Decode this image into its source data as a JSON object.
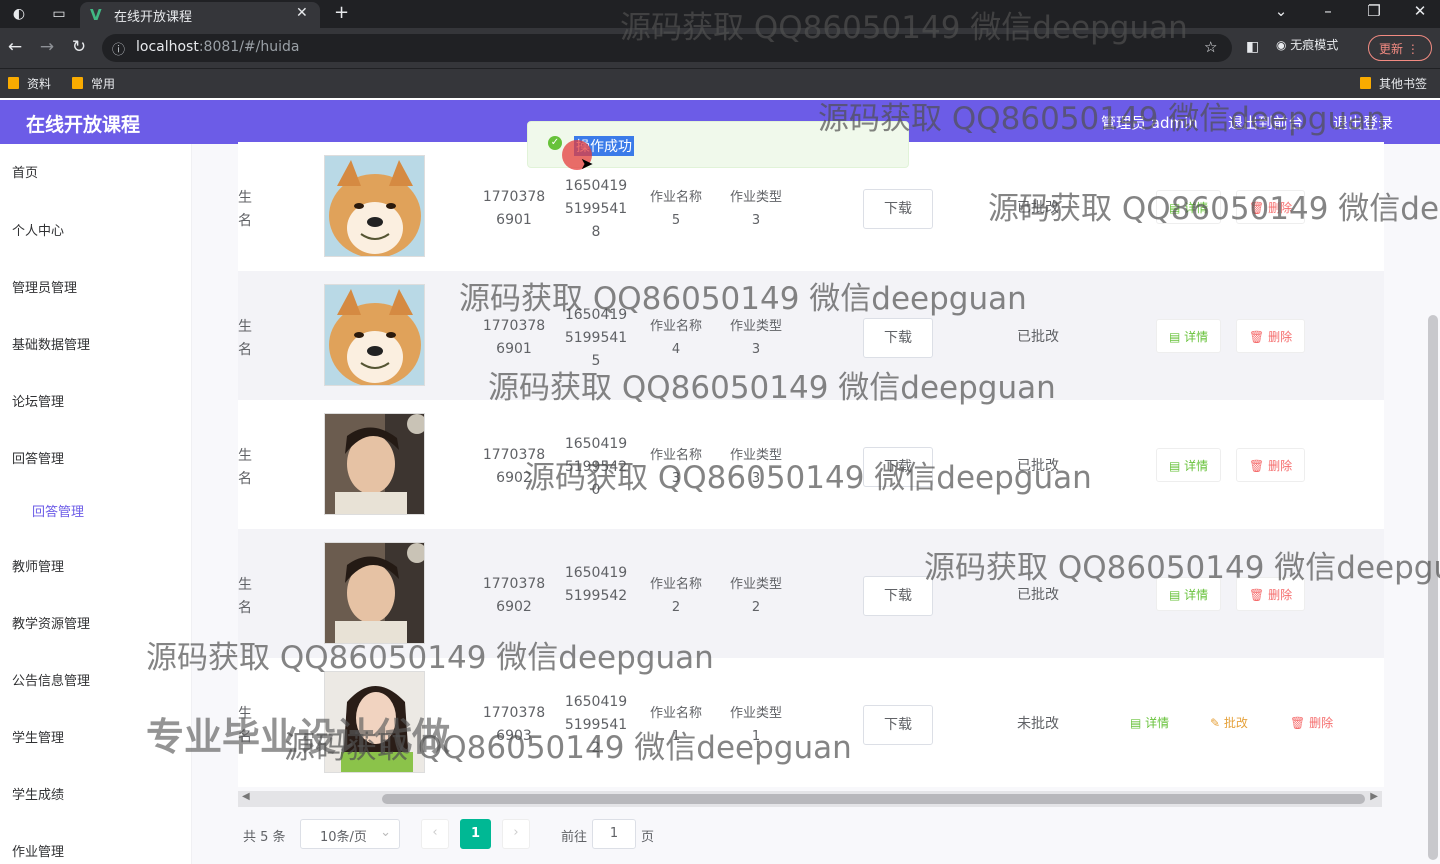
{
  "browser": {
    "tab_title": "在线开放课程",
    "tab_favicon": "V",
    "url_host": "localhost",
    "url_rest": ":8081/#/huida",
    "incognito_label": "无痕模式",
    "update_label": "更新",
    "bookmarks": [
      "资料",
      "常用"
    ],
    "other_bookmarks": "其他书签"
  },
  "header": {
    "title": "在线开放课程",
    "admin_label": "管理员 admin",
    "back_label": "退出到前台",
    "logout_label": "退出登录",
    "color": "#6c5ce7"
  },
  "sidebar": {
    "items": [
      "首页",
      "个人中心",
      "管理员管理",
      "基础数据管理",
      "论坛管理",
      "回答管理",
      "回答管理",
      "教师管理",
      "教学资源管理",
      "公告信息管理",
      "学生管理",
      "学生成绩",
      "作业管理"
    ]
  },
  "toast": {
    "message": "操作成功"
  },
  "table": {
    "rows": [
      {
        "name": "生名",
        "phone_a": "1770378",
        "phone_b": "6901",
        "id_a": "1650419",
        "id_b": "5199541",
        "id_c": "8",
        "hw_label": "作业名称",
        "hw_val": "5",
        "type_label": "作业类型",
        "type_val": "3",
        "download": "下载",
        "status": "已批改",
        "detail": "详情",
        "delete": "删除",
        "avatar": "shiba-dog"
      },
      {
        "name": "生名",
        "phone_a": "1770378",
        "phone_b": "6901",
        "id_a": "1650419",
        "id_b": "5199541",
        "id_c": "5",
        "hw_label": "作业名称",
        "hw_val": "4",
        "type_label": "作业类型",
        "type_val": "3",
        "download": "下载",
        "status": "已批改",
        "detail": "详情",
        "delete": "删除",
        "avatar": "shiba-dog"
      },
      {
        "name": "生名",
        "phone_a": "1770378",
        "phone_b": "6902",
        "id_a": "1650419",
        "id_b": "5199542",
        "id_c": "0",
        "hw_label": "作业名称",
        "hw_val": "3",
        "type_label": "作业类型",
        "type_val": "3",
        "download": "下载",
        "status": "已批改",
        "detail": "详情",
        "delete": "删除",
        "avatar": "young-man"
      },
      {
        "name": "生名",
        "phone_a": "1770378",
        "phone_b": "6902",
        "id_a": "1650419",
        "id_b": "5199542",
        "id_c": "",
        "hw_label": "作业名称",
        "hw_val": "2",
        "type_label": "作业类型",
        "type_val": "2",
        "download": "下载",
        "status": "已批改",
        "detail": "详情",
        "delete": "删除",
        "avatar": "young-man"
      },
      {
        "name": "生名",
        "phone_a": "1770378",
        "phone_b": "6903",
        "id_a": "1650419",
        "id_b": "5199541",
        "id_c": "2",
        "hw_label": "作业名称",
        "hw_val": "1",
        "type_label": "作业类型",
        "type_val": "1",
        "download": "下载",
        "status": "未批改",
        "detail": "详情",
        "review": "批改",
        "delete": "删除",
        "avatar": "young-woman"
      }
    ]
  },
  "pagination": {
    "total": "共 5 条",
    "page_size": "10条/页",
    "current": "1",
    "goto_label": "前往",
    "goto_value": "1",
    "page_unit": "页"
  },
  "watermarks": {
    "text": "源码获取 QQ86050149 微信deepguan",
    "text_cut": "源码获取 QQ86050149 微信deep",
    "text_cut2": "源码获取 QQ86050149 微信deepgua",
    "big": "专业毕业设计代做"
  }
}
